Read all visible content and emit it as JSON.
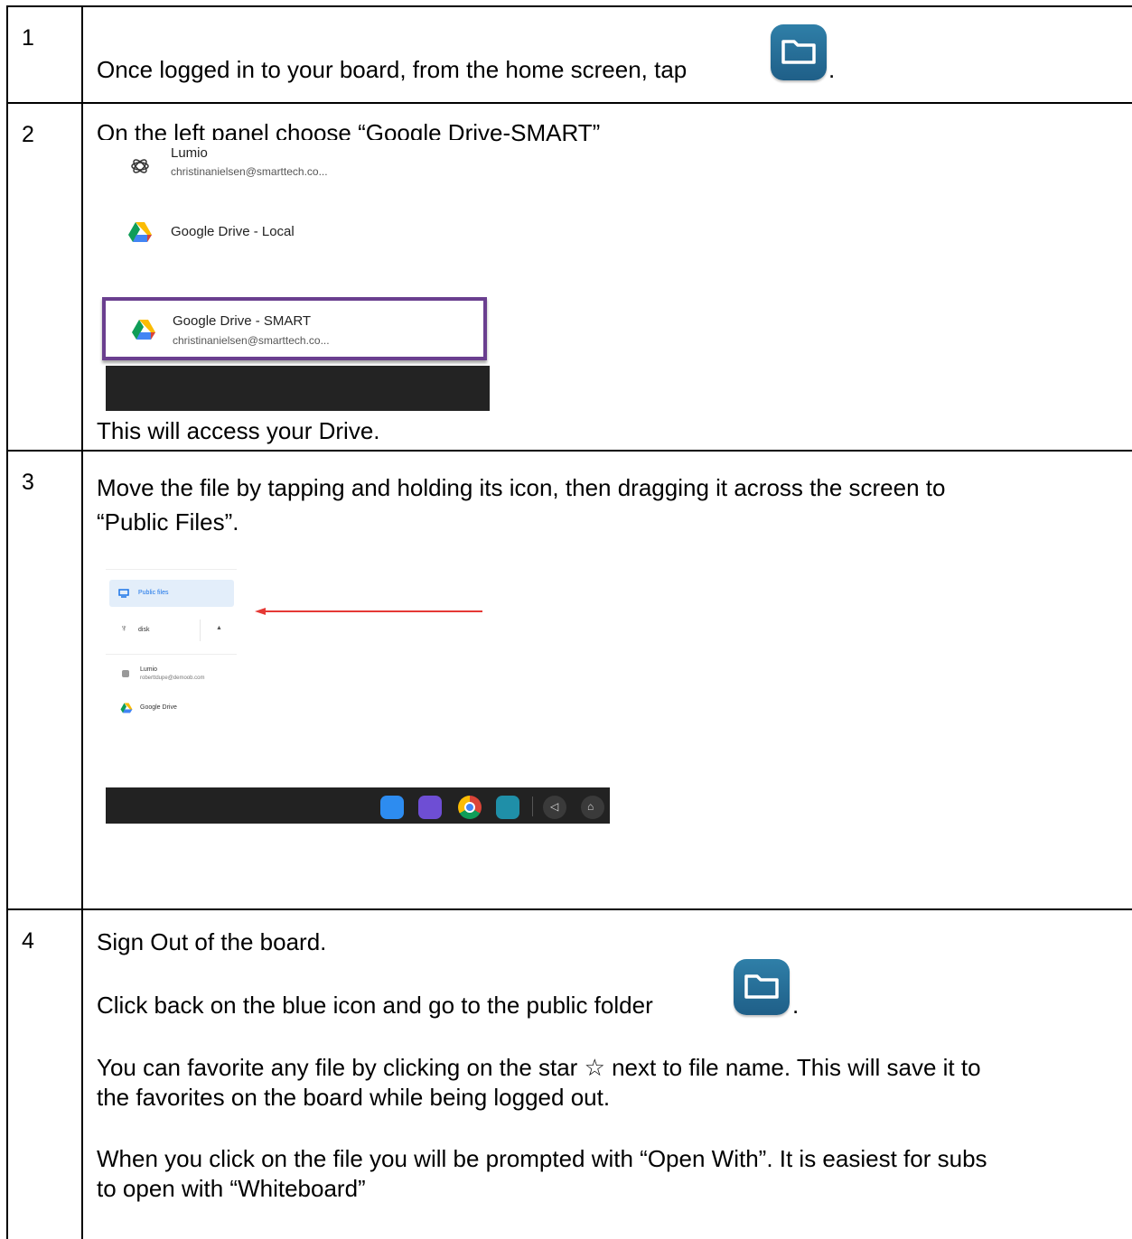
{
  "rows": [
    {
      "number": "1",
      "text": "Once logged in to your board, from the home screen, tap",
      "suffix": "."
    },
    {
      "number": "2",
      "text": "On the left panel choose “Google Drive-SMART”",
      "panel": {
        "items": [
          {
            "label": "Lumio",
            "sub": "christinanielsen@smarttech.co..."
          },
          {
            "label": "Google Drive - Local",
            "sub": ""
          },
          {
            "label": "Google Drive - SMART",
            "sub": "christinanielsen@smarttech.co..."
          }
        ],
        "highlight_color": "#6a3f8f"
      },
      "footer": "This will access your Drive."
    },
    {
      "number": "3",
      "text_line1": "Move the file by tapping and holding its icon, then dragging it across the screen to",
      "text_line2": "“Public Files”.",
      "screenshot": {
        "items": [
          "Public files",
          "disk",
          "Lumio",
          "roberttdupe@demoob.com",
          "Google Drive"
        ],
        "arrow_color": "#e53935"
      }
    },
    {
      "number": "4",
      "line1": "Sign Out of the board.",
      "line2": "Click back on the blue icon and go to the public folder",
      "line2_suffix": ".",
      "line3a": "You can favorite any file by clicking on the star ☆ next to file name.  This will save it to",
      "line3b": "the favorites on the board while being logged out.",
      "line4a": "When you click on the file you will be prompted with “Open With”.  It is easiest for subs",
      "line4b": "to open with “Whiteboard”"
    }
  ],
  "icons": {
    "files_app": "folder-icon",
    "lumio": "lumio-icon",
    "drive": "google-drive-icon"
  }
}
